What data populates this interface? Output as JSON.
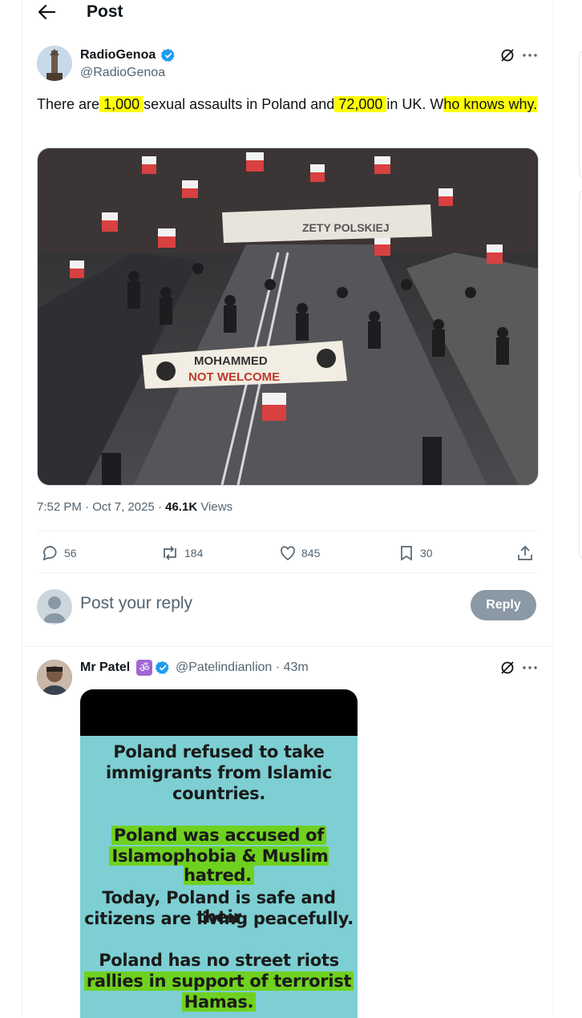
{
  "header": {
    "title": "Post",
    "back_icon": "arrow-left-icon"
  },
  "post": {
    "author_name": "RadioGenoa",
    "author_handle": "@RadioGenoa",
    "text_parts": [
      "There are",
      "1,000",
      "sexual assaults in Poland and",
      "72,000",
      "in UK. W",
      "ho knows why."
    ],
    "image_banner_main": "MOHAMMED",
    "image_banner_sub": "NOT WELCOME",
    "image_banner_top": "ZETY POLSKIEJ",
    "time": "7:52 PM",
    "date": "Oct 7, 2025",
    "views_count": "46.1K",
    "views_label": "Views",
    "stats": {
      "replies": "56",
      "reposts": "184",
      "likes": "845",
      "bookmarks": "30"
    }
  },
  "composer": {
    "placeholder": "Post your reply",
    "button": "Reply"
  },
  "reply": {
    "author_name": "Mr Patel",
    "badge": "ॐ",
    "author_handle": "@Patelindianlion",
    "time": "· 43m",
    "image_lines": [
      "Poland refused to take",
      "immigrants from Islamic",
      "countries.",
      "Poland was accused of",
      "Islamophobia & Muslim hatred.",
      "Today, Poland is safe and their",
      "citizens are living peacefully.",
      "Poland has no street riots and",
      "rallies in support of terrorist",
      "Hamas."
    ]
  },
  "colors": {
    "highlight": "#ffff00",
    "verified": "#1d9bf0",
    "reply_button": "#8b98a5",
    "meme_bg": "#7dcfd3",
    "meme_highlight": "#6fd11f"
  }
}
